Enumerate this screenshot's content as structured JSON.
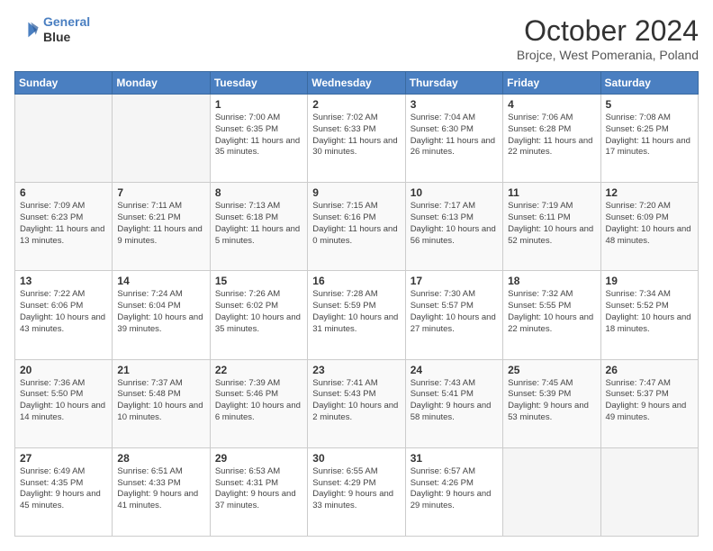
{
  "header": {
    "logo_line1": "General",
    "logo_line2": "Blue",
    "month": "October 2024",
    "location": "Brojce, West Pomerania, Poland"
  },
  "weekdays": [
    "Sunday",
    "Monday",
    "Tuesday",
    "Wednesday",
    "Thursday",
    "Friday",
    "Saturday"
  ],
  "weeks": [
    [
      {
        "day": "",
        "empty": true
      },
      {
        "day": "",
        "empty": true
      },
      {
        "day": "1",
        "sunrise": "7:00 AM",
        "sunset": "6:35 PM",
        "daylight": "11 hours and 35 minutes."
      },
      {
        "day": "2",
        "sunrise": "7:02 AM",
        "sunset": "6:33 PM",
        "daylight": "11 hours and 30 minutes."
      },
      {
        "day": "3",
        "sunrise": "7:04 AM",
        "sunset": "6:30 PM",
        "daylight": "11 hours and 26 minutes."
      },
      {
        "day": "4",
        "sunrise": "7:06 AM",
        "sunset": "6:28 PM",
        "daylight": "11 hours and 22 minutes."
      },
      {
        "day": "5",
        "sunrise": "7:08 AM",
        "sunset": "6:25 PM",
        "daylight": "11 hours and 17 minutes."
      }
    ],
    [
      {
        "day": "6",
        "sunrise": "7:09 AM",
        "sunset": "6:23 PM",
        "daylight": "11 hours and 13 minutes."
      },
      {
        "day": "7",
        "sunrise": "7:11 AM",
        "sunset": "6:21 PM",
        "daylight": "11 hours and 9 minutes."
      },
      {
        "day": "8",
        "sunrise": "7:13 AM",
        "sunset": "6:18 PM",
        "daylight": "11 hours and 5 minutes."
      },
      {
        "day": "9",
        "sunrise": "7:15 AM",
        "sunset": "6:16 PM",
        "daylight": "11 hours and 0 minutes."
      },
      {
        "day": "10",
        "sunrise": "7:17 AM",
        "sunset": "6:13 PM",
        "daylight": "10 hours and 56 minutes."
      },
      {
        "day": "11",
        "sunrise": "7:19 AM",
        "sunset": "6:11 PM",
        "daylight": "10 hours and 52 minutes."
      },
      {
        "day": "12",
        "sunrise": "7:20 AM",
        "sunset": "6:09 PM",
        "daylight": "10 hours and 48 minutes."
      }
    ],
    [
      {
        "day": "13",
        "sunrise": "7:22 AM",
        "sunset": "6:06 PM",
        "daylight": "10 hours and 43 minutes."
      },
      {
        "day": "14",
        "sunrise": "7:24 AM",
        "sunset": "6:04 PM",
        "daylight": "10 hours and 39 minutes."
      },
      {
        "day": "15",
        "sunrise": "7:26 AM",
        "sunset": "6:02 PM",
        "daylight": "10 hours and 35 minutes."
      },
      {
        "day": "16",
        "sunrise": "7:28 AM",
        "sunset": "5:59 PM",
        "daylight": "10 hours and 31 minutes."
      },
      {
        "day": "17",
        "sunrise": "7:30 AM",
        "sunset": "5:57 PM",
        "daylight": "10 hours and 27 minutes."
      },
      {
        "day": "18",
        "sunrise": "7:32 AM",
        "sunset": "5:55 PM",
        "daylight": "10 hours and 22 minutes."
      },
      {
        "day": "19",
        "sunrise": "7:34 AM",
        "sunset": "5:52 PM",
        "daylight": "10 hours and 18 minutes."
      }
    ],
    [
      {
        "day": "20",
        "sunrise": "7:36 AM",
        "sunset": "5:50 PM",
        "daylight": "10 hours and 14 minutes."
      },
      {
        "day": "21",
        "sunrise": "7:37 AM",
        "sunset": "5:48 PM",
        "daylight": "10 hours and 10 minutes."
      },
      {
        "day": "22",
        "sunrise": "7:39 AM",
        "sunset": "5:46 PM",
        "daylight": "10 hours and 6 minutes."
      },
      {
        "day": "23",
        "sunrise": "7:41 AM",
        "sunset": "5:43 PM",
        "daylight": "10 hours and 2 minutes."
      },
      {
        "day": "24",
        "sunrise": "7:43 AM",
        "sunset": "5:41 PM",
        "daylight": "9 hours and 58 minutes."
      },
      {
        "day": "25",
        "sunrise": "7:45 AM",
        "sunset": "5:39 PM",
        "daylight": "9 hours and 53 minutes."
      },
      {
        "day": "26",
        "sunrise": "7:47 AM",
        "sunset": "5:37 PM",
        "daylight": "9 hours and 49 minutes."
      }
    ],
    [
      {
        "day": "27",
        "sunrise": "6:49 AM",
        "sunset": "4:35 PM",
        "daylight": "9 hours and 45 minutes."
      },
      {
        "day": "28",
        "sunrise": "6:51 AM",
        "sunset": "4:33 PM",
        "daylight": "9 hours and 41 minutes."
      },
      {
        "day": "29",
        "sunrise": "6:53 AM",
        "sunset": "4:31 PM",
        "daylight": "9 hours and 37 minutes."
      },
      {
        "day": "30",
        "sunrise": "6:55 AM",
        "sunset": "4:29 PM",
        "daylight": "9 hours and 33 minutes."
      },
      {
        "day": "31",
        "sunrise": "6:57 AM",
        "sunset": "4:26 PM",
        "daylight": "9 hours and 29 minutes."
      },
      {
        "day": "",
        "empty": true
      },
      {
        "day": "",
        "empty": true
      }
    ]
  ]
}
